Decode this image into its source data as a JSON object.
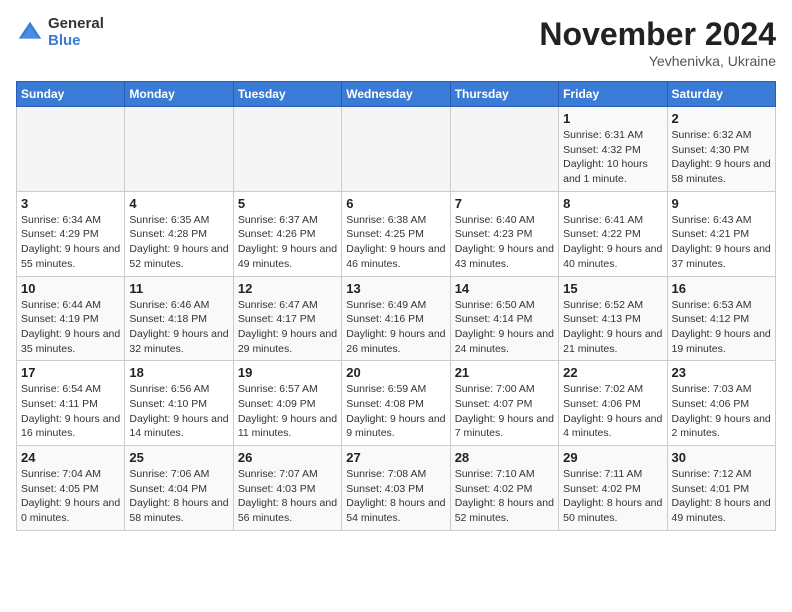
{
  "logo": {
    "general": "General",
    "blue": "Blue"
  },
  "title": {
    "month": "November 2024",
    "location": "Yevhenivka, Ukraine"
  },
  "weekdays": [
    "Sunday",
    "Monday",
    "Tuesday",
    "Wednesday",
    "Thursday",
    "Friday",
    "Saturday"
  ],
  "weeks": [
    [
      {
        "day": "",
        "info": ""
      },
      {
        "day": "",
        "info": ""
      },
      {
        "day": "",
        "info": ""
      },
      {
        "day": "",
        "info": ""
      },
      {
        "day": "",
        "info": ""
      },
      {
        "day": "1",
        "info": "Sunrise: 6:31 AM\nSunset: 4:32 PM\nDaylight: 10 hours and 1 minute."
      },
      {
        "day": "2",
        "info": "Sunrise: 6:32 AM\nSunset: 4:30 PM\nDaylight: 9 hours and 58 minutes."
      }
    ],
    [
      {
        "day": "3",
        "info": "Sunrise: 6:34 AM\nSunset: 4:29 PM\nDaylight: 9 hours and 55 minutes."
      },
      {
        "day": "4",
        "info": "Sunrise: 6:35 AM\nSunset: 4:28 PM\nDaylight: 9 hours and 52 minutes."
      },
      {
        "day": "5",
        "info": "Sunrise: 6:37 AM\nSunset: 4:26 PM\nDaylight: 9 hours and 49 minutes."
      },
      {
        "day": "6",
        "info": "Sunrise: 6:38 AM\nSunset: 4:25 PM\nDaylight: 9 hours and 46 minutes."
      },
      {
        "day": "7",
        "info": "Sunrise: 6:40 AM\nSunset: 4:23 PM\nDaylight: 9 hours and 43 minutes."
      },
      {
        "day": "8",
        "info": "Sunrise: 6:41 AM\nSunset: 4:22 PM\nDaylight: 9 hours and 40 minutes."
      },
      {
        "day": "9",
        "info": "Sunrise: 6:43 AM\nSunset: 4:21 PM\nDaylight: 9 hours and 37 minutes."
      }
    ],
    [
      {
        "day": "10",
        "info": "Sunrise: 6:44 AM\nSunset: 4:19 PM\nDaylight: 9 hours and 35 minutes."
      },
      {
        "day": "11",
        "info": "Sunrise: 6:46 AM\nSunset: 4:18 PM\nDaylight: 9 hours and 32 minutes."
      },
      {
        "day": "12",
        "info": "Sunrise: 6:47 AM\nSunset: 4:17 PM\nDaylight: 9 hours and 29 minutes."
      },
      {
        "day": "13",
        "info": "Sunrise: 6:49 AM\nSunset: 4:16 PM\nDaylight: 9 hours and 26 minutes."
      },
      {
        "day": "14",
        "info": "Sunrise: 6:50 AM\nSunset: 4:14 PM\nDaylight: 9 hours and 24 minutes."
      },
      {
        "day": "15",
        "info": "Sunrise: 6:52 AM\nSunset: 4:13 PM\nDaylight: 9 hours and 21 minutes."
      },
      {
        "day": "16",
        "info": "Sunrise: 6:53 AM\nSunset: 4:12 PM\nDaylight: 9 hours and 19 minutes."
      }
    ],
    [
      {
        "day": "17",
        "info": "Sunrise: 6:54 AM\nSunset: 4:11 PM\nDaylight: 9 hours and 16 minutes."
      },
      {
        "day": "18",
        "info": "Sunrise: 6:56 AM\nSunset: 4:10 PM\nDaylight: 9 hours and 14 minutes."
      },
      {
        "day": "19",
        "info": "Sunrise: 6:57 AM\nSunset: 4:09 PM\nDaylight: 9 hours and 11 minutes."
      },
      {
        "day": "20",
        "info": "Sunrise: 6:59 AM\nSunset: 4:08 PM\nDaylight: 9 hours and 9 minutes."
      },
      {
        "day": "21",
        "info": "Sunrise: 7:00 AM\nSunset: 4:07 PM\nDaylight: 9 hours and 7 minutes."
      },
      {
        "day": "22",
        "info": "Sunrise: 7:02 AM\nSunset: 4:06 PM\nDaylight: 9 hours and 4 minutes."
      },
      {
        "day": "23",
        "info": "Sunrise: 7:03 AM\nSunset: 4:06 PM\nDaylight: 9 hours and 2 minutes."
      }
    ],
    [
      {
        "day": "24",
        "info": "Sunrise: 7:04 AM\nSunset: 4:05 PM\nDaylight: 9 hours and 0 minutes."
      },
      {
        "day": "25",
        "info": "Sunrise: 7:06 AM\nSunset: 4:04 PM\nDaylight: 8 hours and 58 minutes."
      },
      {
        "day": "26",
        "info": "Sunrise: 7:07 AM\nSunset: 4:03 PM\nDaylight: 8 hours and 56 minutes."
      },
      {
        "day": "27",
        "info": "Sunrise: 7:08 AM\nSunset: 4:03 PM\nDaylight: 8 hours and 54 minutes."
      },
      {
        "day": "28",
        "info": "Sunrise: 7:10 AM\nSunset: 4:02 PM\nDaylight: 8 hours and 52 minutes."
      },
      {
        "day": "29",
        "info": "Sunrise: 7:11 AM\nSunset: 4:02 PM\nDaylight: 8 hours and 50 minutes."
      },
      {
        "day": "30",
        "info": "Sunrise: 7:12 AM\nSunset: 4:01 PM\nDaylight: 8 hours and 49 minutes."
      }
    ]
  ]
}
